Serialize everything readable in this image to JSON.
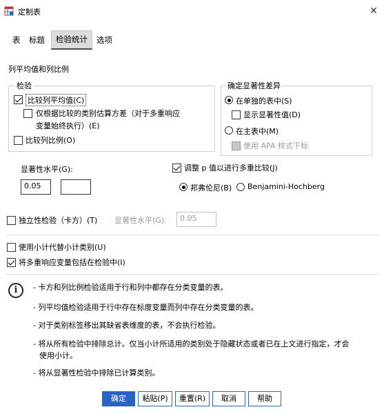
{
  "window": {
    "title": "定制表",
    "close_symbol": "✕"
  },
  "tabs": [
    {
      "label": "表"
    },
    {
      "label": "标题"
    },
    {
      "label": "检验统计"
    },
    {
      "label": "选项"
    }
  ],
  "col_mean_group": {
    "label": "列平均值和列比例",
    "tests_group": {
      "label": "检验",
      "compare_means": {
        "label": "比较列平均值(C)",
        "checked": true
      },
      "estimate_variance": {
        "line1": "仅根据比较的类别估算方差（对于多重响应",
        "line2": "变量始终执行）(E)",
        "checked": false
      },
      "compare_props": {
        "label": "比较列比例(O)",
        "checked": false
      }
    },
    "significance_group": {
      "label": "确定显著性差异",
      "separate_table": {
        "label": "在单独的表中(S)",
        "checked": true
      },
      "show_sig_values": {
        "label": "显示显著性值(D)",
        "checked": false
      },
      "main_table": {
        "label": "在主表中(M)",
        "checked": false
      },
      "apa_style": {
        "label": "使用 APA 样式下标",
        "checked": false
      }
    },
    "sig_level": {
      "label": "显著性水平(G):",
      "value1": "0.05",
      "value2": ""
    },
    "adjust_p": {
      "label": "调整 p 值以进行多重比较(J)",
      "checked": true
    },
    "bonferroni": {
      "label": "邦弗伦尼(B)",
      "checked": true
    },
    "benjamini": {
      "label": "Benjamini-Hochberg",
      "checked": false
    }
  },
  "independence": {
    "label": "独立性检验（卡方）(T)",
    "checked": false,
    "sig_label": "显著性水平(G):",
    "sig_value": "0.05"
  },
  "use_subtotals": {
    "label": "使用小计代替小计类别(U)",
    "checked": false
  },
  "include_multi": {
    "label": "将多重响应变量包括在检验中(I)",
    "checked": true
  },
  "notes": [
    "- 卡方和列比例检验适用于行和列中都存在分类变量的表。",
    "- 列平均值检验适用于行中存在标度变量而列中存在分类变量的表。",
    "- 对于类别标签移出其缺省表维度的表，不会执行检验。",
    "- 将从所有检验中排除总计。仅当小计所适用的类别处于隐藏状态或者已在上文进行指定，才会",
    "使用小计。",
    "- 将从显著性检验中排除已计算类别。"
  ],
  "buttons": {
    "ok": "确定",
    "paste": "粘贴(P)",
    "reset": "重置(R)",
    "cancel": "取消",
    "help": "帮助"
  }
}
